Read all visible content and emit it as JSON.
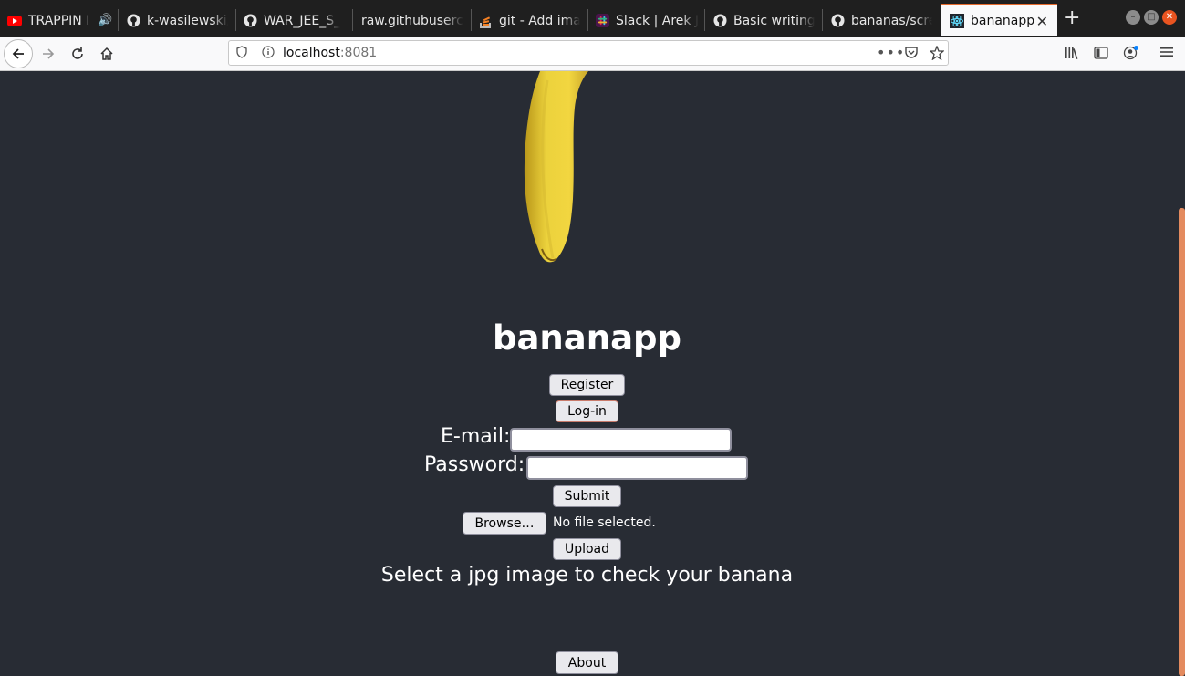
{
  "tabs": [
    {
      "label": "TRAPPIN I",
      "icon": "youtube-icon",
      "audio": true
    },
    {
      "label": "k-wasilewski/",
      "icon": "github-icon"
    },
    {
      "label": "WAR_JEE_S_",
      "icon": "github-icon"
    },
    {
      "label": "raw.githubuserco",
      "icon": "none"
    },
    {
      "label": "git - Add ima",
      "icon": "stackoverflow-icon"
    },
    {
      "label": "Slack | Arek J",
      "icon": "slack-icon"
    },
    {
      "label": "Basic writing",
      "icon": "github-icon"
    },
    {
      "label": "bananas/scre",
      "icon": "github-icon"
    },
    {
      "label": "bananapp",
      "icon": "react-icon",
      "active": true
    }
  ],
  "url": {
    "host": "localhost",
    "port": ":8081"
  },
  "app": {
    "title": "bananapp",
    "register_label": "Register",
    "login_label": "Log-in",
    "email_label": "E-mail:",
    "password_label": "Password:",
    "submit_label": "Submit",
    "browse_label": "Browse…",
    "file_status": "No file selected.",
    "upload_label": "Upload",
    "hint": "Select a jpg image to check your banana",
    "about_label": "About"
  },
  "colors": {
    "background": "#282c34",
    "accent": "#e66a2c",
    "banana": "#e6c733"
  }
}
